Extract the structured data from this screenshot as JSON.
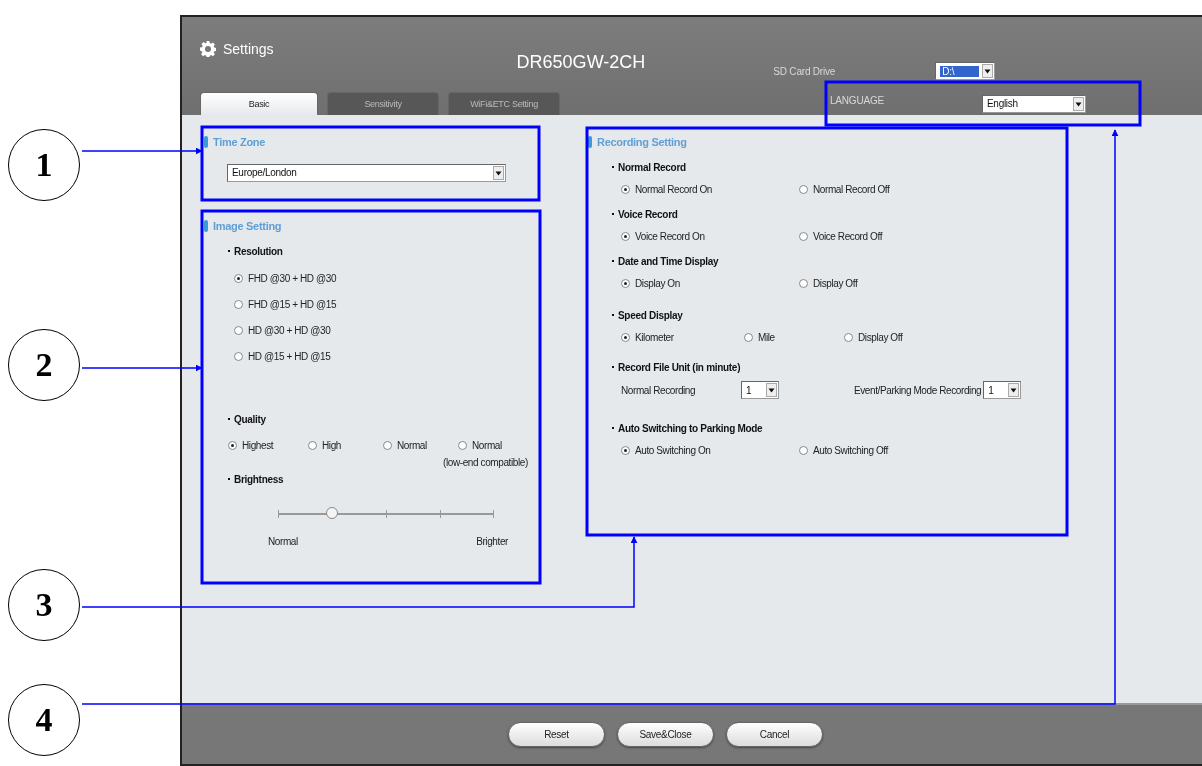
{
  "window": {
    "title": "Settings",
    "model": "DR650GW-2CH"
  },
  "sd_card_drive": {
    "label": "SD Card Drive",
    "value": "D:\\"
  },
  "tabs": [
    {
      "label": "Basic",
      "selected": true
    },
    {
      "label": "Sensitivity",
      "selected": false
    },
    {
      "label": "WiFi&ETC Setting",
      "selected": false
    }
  ],
  "language": {
    "label": "LANGUAGE",
    "value": "English"
  },
  "time_zone": {
    "title": "Time Zone",
    "value": "Europe/London"
  },
  "image_setting": {
    "title": "Image Setting",
    "resolution": {
      "label": "Resolution",
      "options": [
        {
          "label": "FHD @30 + HD @30",
          "selected": true
        },
        {
          "label": "FHD @15 + HD @15",
          "selected": false
        },
        {
          "label": "HD @30 + HD @30",
          "selected": false
        },
        {
          "label": "HD @15 + HD @15",
          "selected": false
        }
      ]
    },
    "quality": {
      "label": "Quality",
      "options": [
        {
          "label": "Highest",
          "selected": true
        },
        {
          "label": "High",
          "selected": false
        },
        {
          "label": "Normal",
          "selected": false
        },
        {
          "label": "Normal",
          "note": "(low-end compatible)",
          "selected": false
        }
      ]
    },
    "brightness": {
      "label": "Brightness",
      "level": 0.25,
      "min_label": "Normal",
      "max_label": "Brighter"
    }
  },
  "recording_setting": {
    "title": "Recording Setting",
    "groups": [
      {
        "kind": "radio",
        "label": "Normal Record",
        "options": [
          {
            "label": "Normal Record On",
            "selected": true
          },
          {
            "label": "Normal Record Off",
            "selected": false
          }
        ]
      },
      {
        "kind": "radio",
        "label": "Voice Record",
        "options": [
          {
            "label": "Voice Record On",
            "selected": true
          },
          {
            "label": "Voice Record Off",
            "selected": false
          }
        ]
      },
      {
        "kind": "radio",
        "label": "Date and Time Display",
        "options": [
          {
            "label": "Display On",
            "selected": true
          },
          {
            "label": "Display Off",
            "selected": false
          }
        ]
      },
      {
        "kind": "radio",
        "label": "Speed Display",
        "options": [
          {
            "label": "Kilometer",
            "selected": true
          },
          {
            "label": "Mile",
            "selected": false
          },
          {
            "label": "Display Off",
            "selected": false
          }
        ]
      },
      {
        "kind": "dropdowns",
        "label": "Record File Unit (in minute)",
        "fields": [
          {
            "label": "Normal Recording",
            "value": "1"
          },
          {
            "label": "Event/Parking Mode Recording",
            "value": "1"
          }
        ]
      },
      {
        "kind": "radio",
        "label": "Auto Switching to Parking Mode",
        "options": [
          {
            "label": "Auto Switching On",
            "selected": true
          },
          {
            "label": "Auto Switching Off",
            "selected": false
          }
        ]
      }
    ]
  },
  "buttons": [
    "Reset",
    "Save&Close",
    "Cancel"
  ],
  "callouts": [
    "1",
    "2",
    "3",
    "4"
  ]
}
